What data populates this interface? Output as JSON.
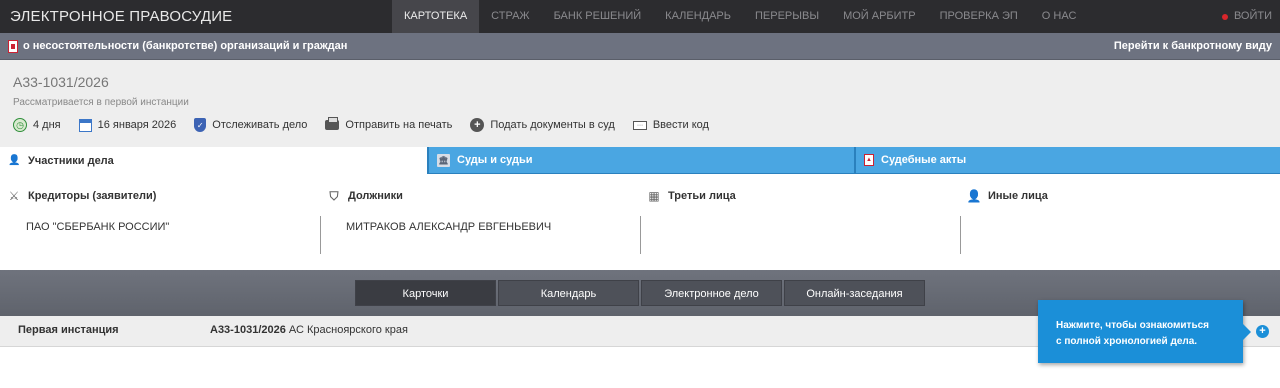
{
  "header": {
    "brand": "ЭЛЕКТРОННОЕ ПРАВОСУДИЕ",
    "nav": [
      "КАРТОТЕКА",
      "СТРАЖ",
      "БАНК РЕШЕНИЙ",
      "КАЛЕНДАРЬ",
      "ПЕРЕРЫВЫ",
      "МОЙ АРБИТР",
      "ПРОВЕРКА ЭП",
      "О НАС"
    ],
    "login": "ВОЙТИ"
  },
  "section": {
    "title": "о несостоятельности (банкротстве) организаций и граждан",
    "link": "Перейти к банкротному виду"
  },
  "case": {
    "number": "А33-1031/2026",
    "status": "Рассматривается в первой инстанции",
    "actions": {
      "days": "4 дня",
      "date": "16 января 2026",
      "track": "Отслеживать дело",
      "print": "Отправить на печать",
      "submit": "Подать документы в суд",
      "code": "Ввести код"
    }
  },
  "tabs": {
    "participants": "Участники дела",
    "courts": "Суды и судьи",
    "acts": "Судебные акты"
  },
  "participants": {
    "creditors": {
      "label": "Кредиторы (заявители)",
      "value": "ПАО \"СБЕРБАНК РОССИИ\""
    },
    "debtors": {
      "label": "Должники",
      "value": "МИТРАКОВ АЛЕКСАНДР ЕВГЕНЬЕВИЧ"
    },
    "third": {
      "label": "Третьи лица",
      "value": ""
    },
    "other": {
      "label": "Иные лица",
      "value": ""
    }
  },
  "subtabs": [
    "Карточки",
    "Календарь",
    "Электронное дело",
    "Онлайн-заседания"
  ],
  "instance": {
    "label": "Первая инстанция",
    "case": "А33-1031/2026",
    "court": "АС Красноярского края"
  },
  "tooltip": {
    "line1": "Нажмите, чтобы ознакомиться",
    "line2": "с полной хронологией дела."
  }
}
